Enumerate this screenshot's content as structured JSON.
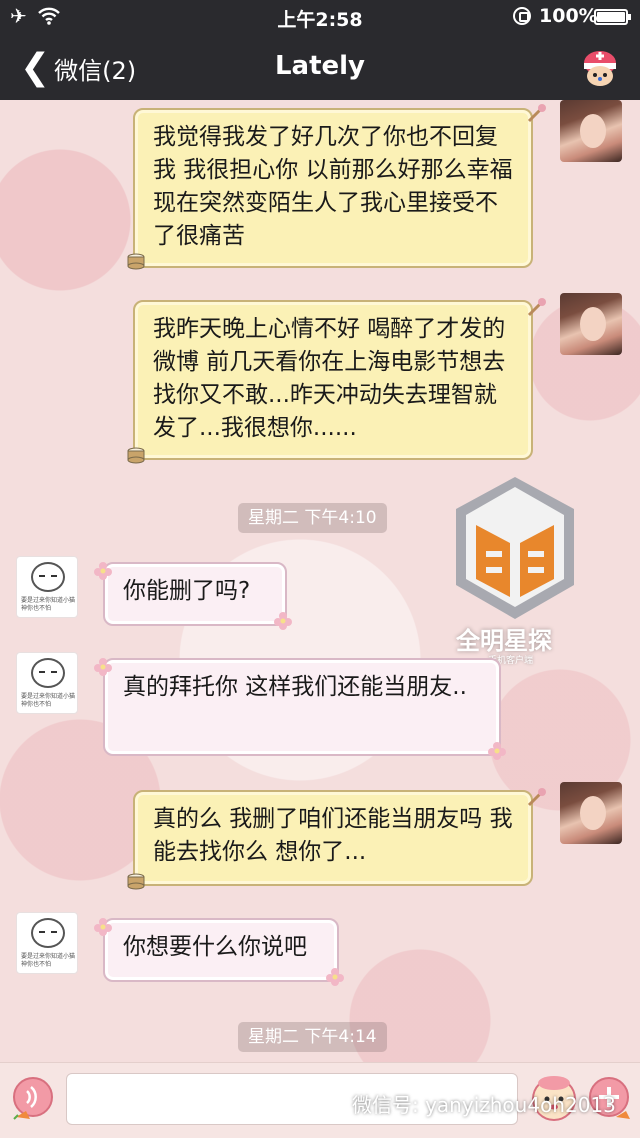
{
  "status_bar": {
    "time": "上午2:58",
    "battery": "100%"
  },
  "nav": {
    "back_label": "微信(2)",
    "title": "Lately"
  },
  "messages": [
    {
      "direction": "out",
      "text": "我觉得我发了好几次了你也不回复我 我很担心你 以前那么好那么幸福 现在突然变陌生人了我心里接受不了很痛苦"
    },
    {
      "direction": "out",
      "text": "我昨天晚上心情不好 喝醉了才发的微博 前几天看你在上海电影节想去找你又不敢...昨天冲动失去理智就发了...我很想你......"
    },
    {
      "direction": "time",
      "text": "星期二 下午4:10"
    },
    {
      "direction": "in",
      "text": "你能删了吗?"
    },
    {
      "direction": "in",
      "text": "真的拜托你 这样我们还能当朋友.."
    },
    {
      "direction": "out",
      "text": "真的么 我删了咱们还能当朋友吗 我能去找你么 想你了..."
    },
    {
      "direction": "in",
      "text": "你想要什么你说吧"
    },
    {
      "direction": "time",
      "text": "星期二 下午4:14"
    }
  ],
  "contact_avatar_caption": "要是过来你知道小猫神你也不怕",
  "watermark": {
    "logo_title": "全明星探",
    "logo_sub": "手机客户端",
    "wechat_id": "微信号: yanyizhou4oh2013"
  },
  "colors": {
    "bar_bg": "#2a2a2e",
    "outgoing_bubble": "#fbf1b6",
    "incoming_bubble": "#fbeff4",
    "chat_bg": "#f4dedd"
  },
  "icons": {
    "status_left": [
      "airplane-icon",
      "wifi-icon"
    ],
    "status_right": [
      "rotation-lock-icon",
      "battery-icon"
    ],
    "nav_right": "tony-chopper-icon",
    "input_left": "voice-icon",
    "input_right": [
      "emoji-icon",
      "plus-icon"
    ]
  }
}
